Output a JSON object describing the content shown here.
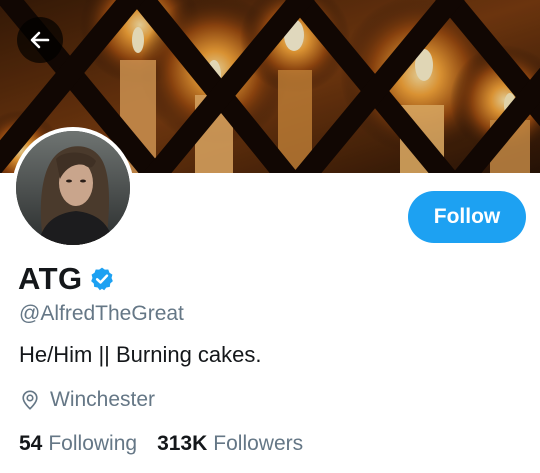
{
  "header": {
    "back_icon": "arrow-left-icon"
  },
  "profile": {
    "display_name": "ATG",
    "verified_icon": "verified-badge-icon",
    "handle": "@AlfredTheGreat",
    "bio": "He/Him || Burning cakes.",
    "location": "Winchester",
    "location_icon": "location-pin-icon",
    "follow_label": "Follow",
    "following_count": "54",
    "following_label": "Following",
    "followers_count": "313K",
    "followers_label": "Followers"
  },
  "colors": {
    "accent": "#1da1f2",
    "secondary_text": "#657786",
    "primary_text": "#14171a"
  }
}
